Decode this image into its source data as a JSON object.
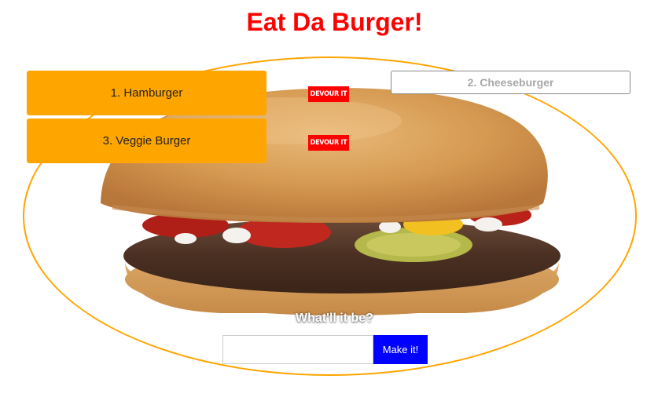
{
  "page": {
    "title": "Eat Da Burger!"
  },
  "menu": {
    "items": [
      {
        "label": "1. Hamburger",
        "action_label": "DEVOUR IT"
      },
      {
        "label": "3. Veggie Burger",
        "action_label": "DEVOUR IT"
      }
    ]
  },
  "devoured": {
    "items": [
      {
        "label": "2. Cheeseburger"
      }
    ]
  },
  "form": {
    "prompt": "What'll it be?",
    "input_value": "",
    "input_placeholder": "",
    "submit_label": "Make it!"
  },
  "colors": {
    "title": "#ff0000",
    "menu_item_bg": "#ffa500",
    "devour_button_bg": "#ff0000",
    "submit_button_bg": "#0000ff",
    "plate_border": "#ffa500",
    "devoured_text": "#a8a8a8"
  },
  "icons": {
    "background": "burger-photo-icon"
  }
}
